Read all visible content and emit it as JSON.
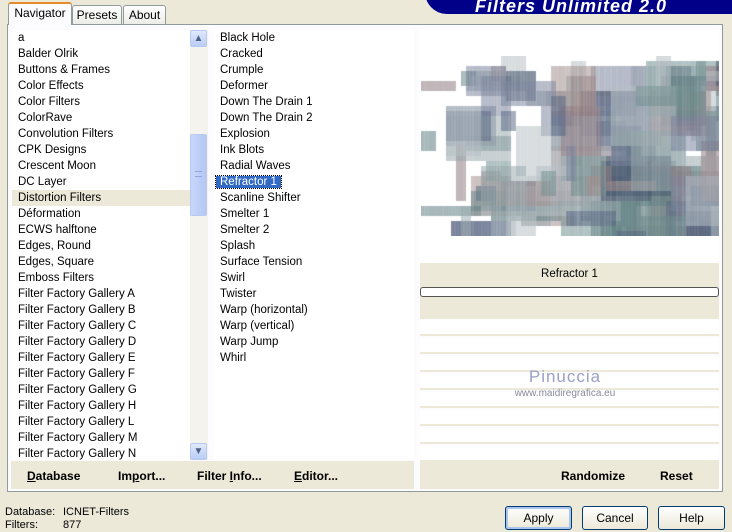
{
  "app": {
    "logo": "Filters Unlimited 2.0"
  },
  "tabs": [
    {
      "label": "Navigator",
      "active": true
    },
    {
      "label": "Presets"
    },
    {
      "label": "About"
    }
  ],
  "categories": [
    "a",
    "Balder Olrik",
    "Buttons & Frames",
    "Color Effects",
    "Color Filters",
    "ColorRave",
    "Convolution Filters",
    "CPK Designs",
    "Crescent Moon",
    "DC Layer",
    "Distortion Filters",
    "Déformation",
    "ECWS halftone",
    "Edges, Round",
    "Edges, Square",
    "Emboss Filters",
    "Filter Factory Gallery A",
    "Filter Factory Gallery B",
    "Filter Factory Gallery C",
    "Filter Factory Gallery D",
    "Filter Factory Gallery E",
    "Filter Factory Gallery F",
    "Filter Factory Gallery G",
    "Filter Factory Gallery H",
    "Filter Factory Gallery L",
    "Filter Factory Gallery M",
    "Filter Factory Gallery N"
  ],
  "selected_category": "Distortion Filters",
  "filters": [
    "Black Hole",
    "Cracked",
    "Crumple",
    "Deformer",
    "Down The Drain 1",
    "Down The Drain 2",
    "Explosion",
    "Ink Blots",
    "Radial Waves",
    "Refractor 1",
    "Scanline Shifter",
    "Smelter 1",
    "Smelter 2",
    "Splash",
    "Surface Tension",
    "Swirl",
    "Twister",
    "Warp (horizontal)",
    "Warp (vertical)",
    "Warp Jump",
    "Whirl"
  ],
  "selected_filter": "Refractor 1",
  "preview": {
    "filter_name": "Refractor 1",
    "progress": 0
  },
  "watermark": {
    "name": "Pinuccia",
    "url": "www.maidiregrafica.eu"
  },
  "left_buttons": [
    {
      "label": "Database",
      "u": "D"
    },
    {
      "label": "Import...",
      "u": "p"
    },
    {
      "label": "Filter Info...",
      "u": "I"
    },
    {
      "label": "Editor...",
      "u": "E"
    }
  ],
  "right_buttons": {
    "randomize": "Randomize",
    "reset": "Reset"
  },
  "status": {
    "database_label": "Database:",
    "database_value": "ICNET-Filters",
    "filters_label": "Filters:",
    "filters_value": "877"
  },
  "dialog_buttons": {
    "apply": "Apply",
    "cancel": "Cancel",
    "help": "Help"
  },
  "colors": {
    "selection": "#316ac5",
    "logo_bg": "#00008b",
    "face": "#ece9d8"
  }
}
